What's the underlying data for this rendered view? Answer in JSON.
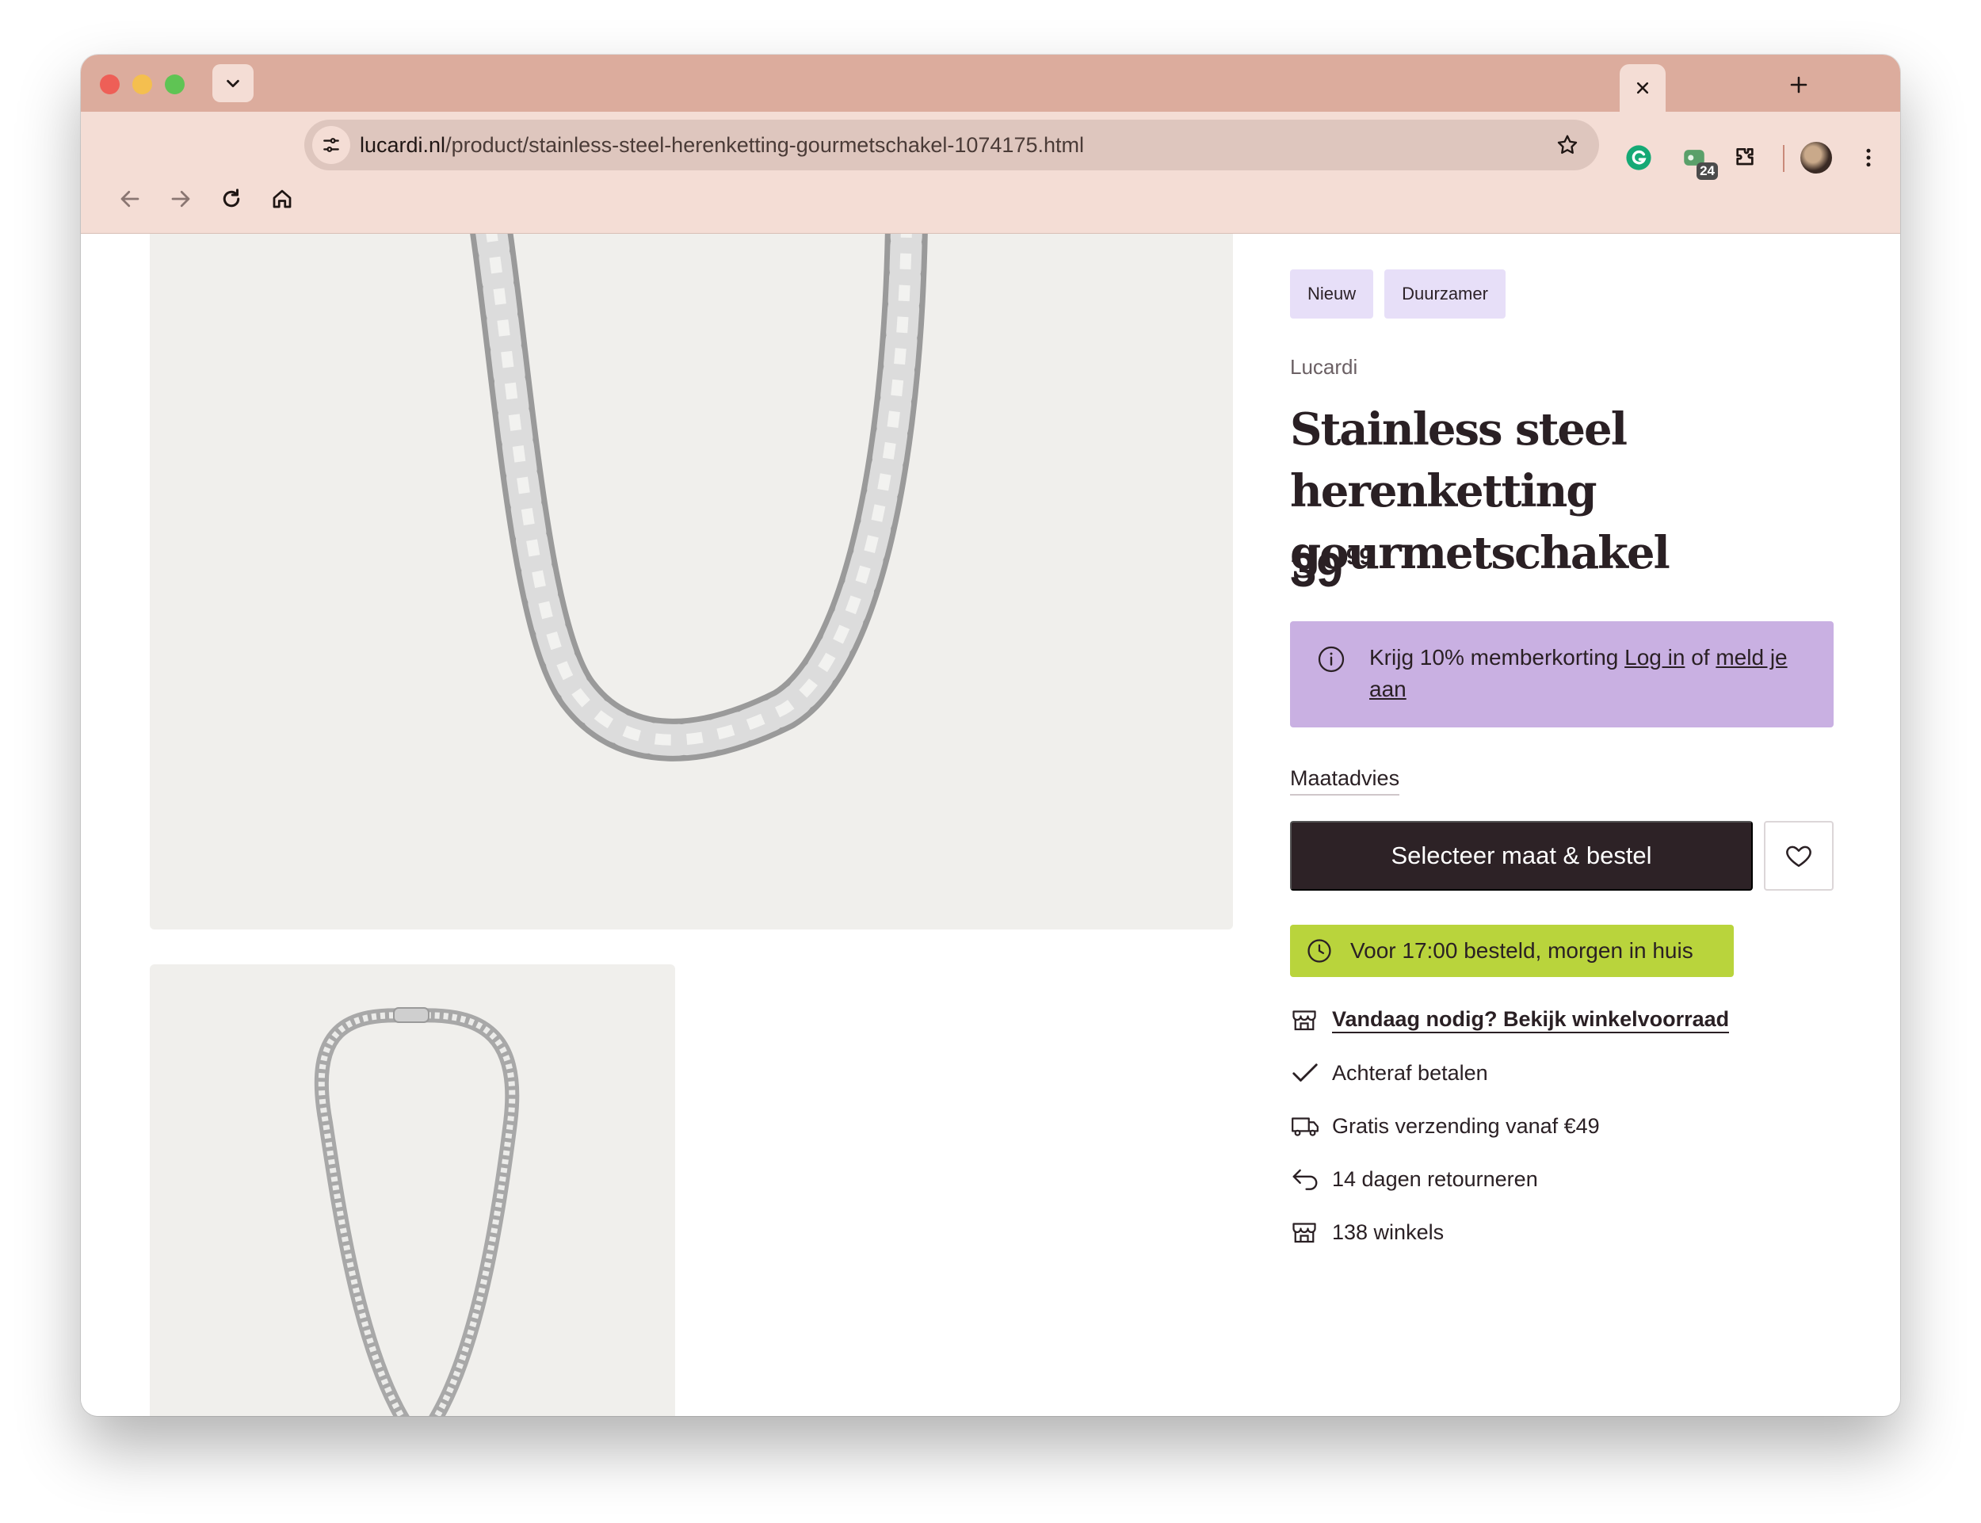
{
  "browser": {
    "url_host": "lucardi.nl",
    "url_path": "/product/stainless-steel-herenketting-gourmetschakel-1074175.html",
    "extension_badge": "24"
  },
  "product": {
    "tags": [
      "Nieuw",
      "Duurzamer"
    ],
    "brand": "Lucardi",
    "title": "Stainless steel herenketting gourmetschakel",
    "price_whole": "39",
    "price_cents": "99"
  },
  "member": {
    "text_before": "Krijg 10% memberkorting ",
    "login_link": "Log in",
    "text_middle": " of ",
    "signup_link": "meld je aan"
  },
  "size_advice": "Maatadvies",
  "cta_label": "Selecteer maat & bestel",
  "delivery_label": "Voor 17:00 besteld, morgen in huis",
  "usps": {
    "store_stock": "Vandaag nodig? Bekijk winkelvoorraad",
    "pay_later": "Achteraf betalen",
    "free_shipping": "Gratis verzending vanaf €49",
    "returns": "14 dagen retourneren",
    "stores": "138 winkels"
  },
  "colors": {
    "tabstrip": "#dcac9d",
    "toolbar": "#f4ddd5",
    "tag_bg": "#e7dff8",
    "member_bg": "#c9b0e2",
    "cta_bg": "#2d2226",
    "delivery_bg": "#b9d43c",
    "image_bg": "#f0efec"
  },
  "icons": {
    "tab_search": "chevron-down-icon",
    "close_tab": "close-icon",
    "new_tab": "plus-icon",
    "back": "arrow-left-icon",
    "forward": "arrow-right-icon",
    "reload": "reload-icon",
    "home": "home-icon",
    "site_info": "tune-icon",
    "bookmark": "star-icon",
    "grammarly": "grammarly-icon",
    "extension": "extension-icon",
    "puzzle": "puzzle-icon",
    "menu": "kebab-menu-icon",
    "member_info": "info-icon",
    "favorite": "heart-icon",
    "delivery": "clock-icon",
    "store": "store-icon",
    "check": "check-icon",
    "truck": "truck-icon",
    "return": "return-arrow-icon"
  }
}
